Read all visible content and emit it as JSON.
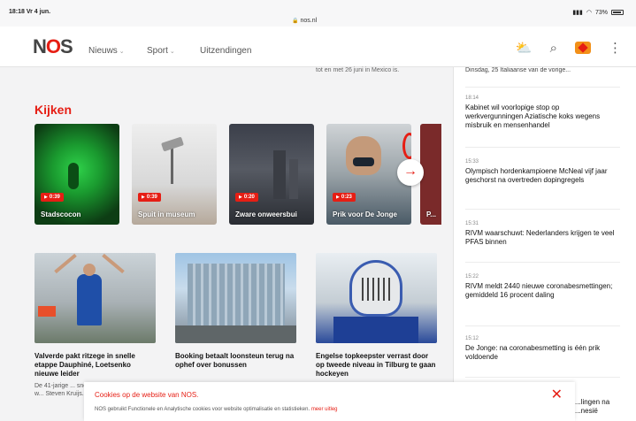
{
  "status": {
    "time": "18:18  Vr 4 jun.",
    "url": "nos.nl",
    "battery": "73%"
  },
  "nav": {
    "logo_prefix": "N",
    "logo_o": "O",
    "logo_suffix": "S",
    "links": [
      "Nieuws",
      "Sport",
      "Uitzendingen"
    ]
  },
  "main": {
    "mexico_text": "tot en met 26 juni in Mexico is.",
    "kijken_title": "Kijken",
    "videos": [
      {
        "duration": "0:39",
        "title": "Stadscocon"
      },
      {
        "duration": "0:39",
        "title": "Spuit in museum"
      },
      {
        "duration": "0:20",
        "title": "Zware onweersbui"
      },
      {
        "duration": "0:23",
        "title": "Prik voor De Jonge"
      },
      {
        "duration": "",
        "title": "P..."
      }
    ],
    "articles": [
      {
        "title": "Valverde pakt ritzege in snelle etappe Dauphiné, Loetsenko nieuwe leider",
        "desc": "De 41-jarige ... snelste op de ... Kelderman w... Steven Kruijs..."
      },
      {
        "title": "Booking betaalt loonsteun terug na ophef over bonussen",
        "desc": ""
      },
      {
        "title": "Engelse topkeepster verrast door op tweede niveau in Tilburg te gaan hockeyen",
        "desc": ""
      }
    ]
  },
  "sidebar": {
    "top_cut": "Dinsdag, 25 Italiaanse van de vorige...",
    "items": [
      {
        "time": "18:14",
        "headline": "Kabinet wil voorlopige stop op werkvergunningen Aziatische koks wegens misbruik en mensenhandel"
      },
      {
        "time": "15:33",
        "headline": "Olympisch hordenkampioene McNeal vijf jaar geschorst na overtreden dopingregels"
      },
      {
        "time": "15:31",
        "headline": "RIVM waarschuwt: Nederlanders krijgen te veel PFAS binnen"
      },
      {
        "time": "15:22",
        "headline": "RIVM meldt 2440 nieuwe coronabesmettingen; gemiddeld 16 procent daling"
      },
      {
        "time": "15:12",
        "headline": "De Jonge: na coronabesmetting is één prik voldoende"
      }
    ],
    "peek": "...lingen na\n...nesië"
  },
  "cookie": {
    "title": "Cookies op de website van NOS.",
    "desc": "NOS gebruikt Functionele en Analytische cookies voor website optimalisatie en statistieken.",
    "more": "meer uitleg"
  }
}
